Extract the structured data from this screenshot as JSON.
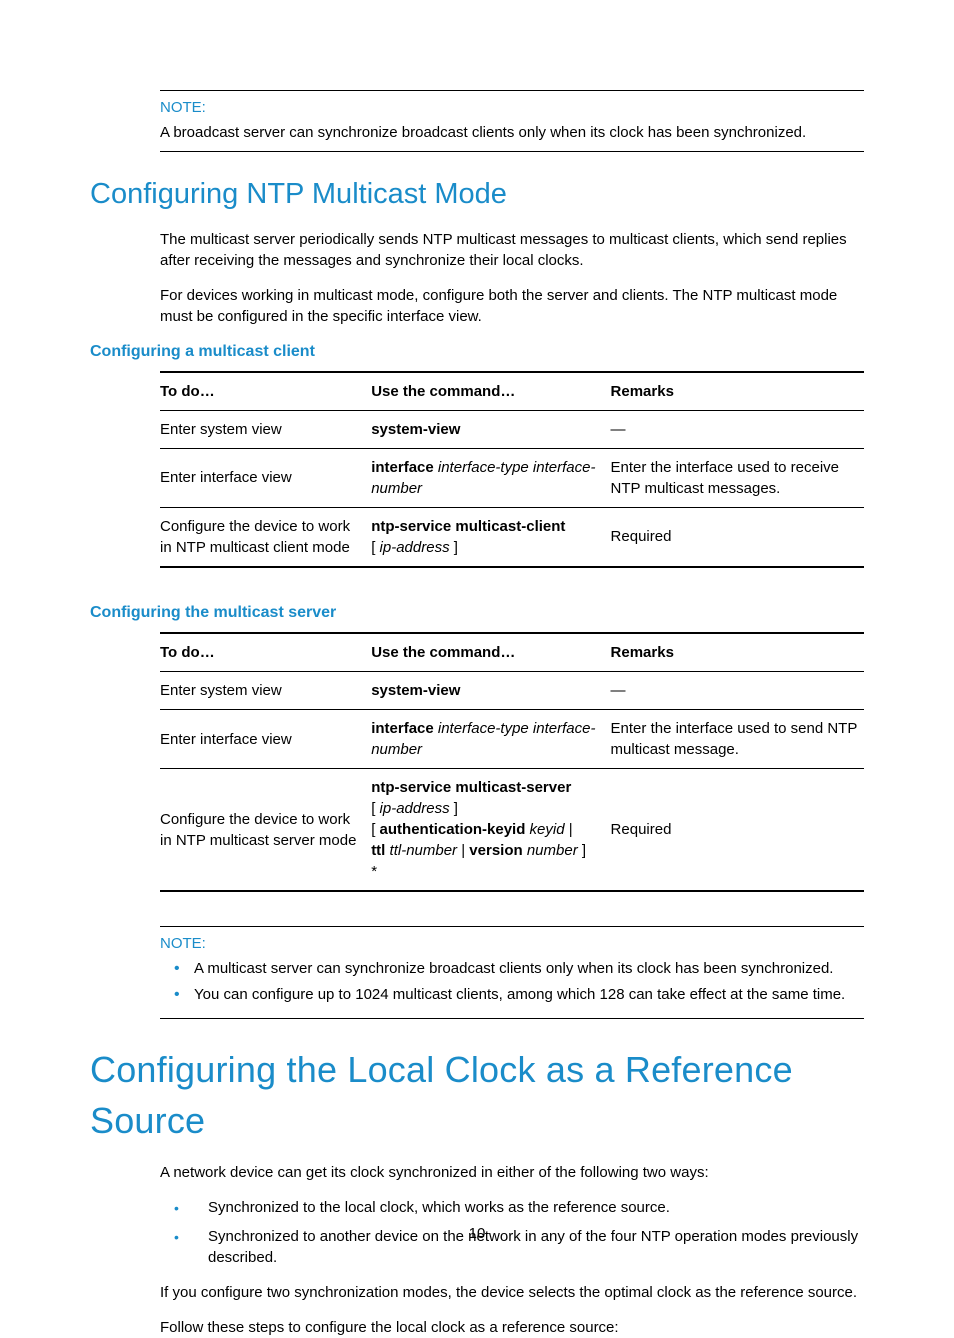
{
  "note1": {
    "label": "NOTE:",
    "text": "A broadcast server can synchronize broadcast clients only when its clock has been synchronized."
  },
  "h2": "Configuring NTP Multicast Mode",
  "p1": "The multicast server periodically sends NTP multicast messages to multicast clients, which send replies after receiving the messages and synchronize their local clocks.",
  "p2": "For devices working in multicast mode, configure both the server and clients. The NTP multicast mode must be configured in the specific interface view.",
  "h3a": "Configuring a multicast client",
  "table_headers": {
    "todo": "To do…",
    "cmd": "Use the command…",
    "rem": "Remarks"
  },
  "table1": {
    "r1": {
      "todo": "Enter system view",
      "cmd_bold": "system-view",
      "rem": "—"
    },
    "r2": {
      "todo": "Enter interface view",
      "cmd_bold": "interface",
      "cmd_it1": " interface-type interface-number",
      "rem": "Enter the interface used to receive NTP multicast messages."
    },
    "r3": {
      "todo": "Configure the device to work in NTP multicast client mode",
      "cmd_bold": "ntp-service multicast-client",
      "cmd_post_pre": " [ ",
      "cmd_post_it": "ip-address",
      "cmd_post_suf": " ]",
      "rem": "Required"
    }
  },
  "h3b": "Configuring the multicast server",
  "table2": {
    "r1": {
      "todo": "Enter system view",
      "cmd_bold": "system-view",
      "rem": "—"
    },
    "r2": {
      "todo": "Enter interface view",
      "cmd_bold": "interface",
      "cmd_it1": " interface-type interface-number",
      "rem": "Enter the interface used to send NTP multicast message."
    },
    "r3": {
      "todo": "Configure the device to work in NTP multicast server mode",
      "l1_bold": "ntp-service multicast-server",
      "l2_pre": "[ ",
      "l2_it": "ip-address",
      "l2_suf": " ]",
      "l3_pre": "[ ",
      "l3_b1": "authentication-keyid",
      "l3_it1": " keyid",
      "l3_suf": " |",
      "l4_b1": "ttl",
      "l4_it1": " ttl-number",
      "l4_mid": " | ",
      "l4_b2": "version",
      "l4_it2": " number",
      "l4_suf": " ]",
      "l5": "*",
      "rem": "Required"
    }
  },
  "note2": {
    "label": "NOTE:",
    "li1": "A multicast server can synchronize broadcast clients only when its clock has been synchronized.",
    "li2": "You can configure up to 1024 multicast clients, among which 128 can take effect at the same time."
  },
  "h1": "Configuring the Local Clock as a Reference Source",
  "p3": "A network device can get its clock synchronized in either of the following two ways:",
  "blist": {
    "li1": "Synchronized to the local clock, which works as the reference source.",
    "li2": "Synchronized to another device on the network in any of the four NTP operation modes previously described."
  },
  "p4": "If you configure two synchronization modes, the device selects the optimal clock as the reference source.",
  "p5": "Follow these steps to configure the local clock as a reference source:",
  "page_number": "10"
}
